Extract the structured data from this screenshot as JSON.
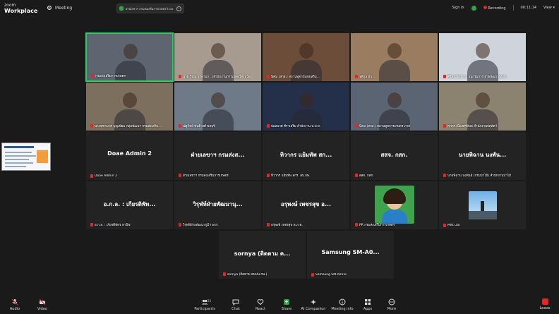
{
  "brand": {
    "line1": "zoom",
    "line2": "Workplace"
  },
  "meeting_label": "Meeting",
  "share_pill_text": "ฝ่ายเลขาฯ กรมส่งเสริมการเกษตร's scr",
  "top_right": {
    "signin": "Sign in",
    "recording": "Recording",
    "timer": "00:11:14",
    "view": "View"
  },
  "tiles": [
    {
      "name": "กรมส่งเสริมการเกษตร",
      "video": true,
      "active": true,
      "bg": "#5d6670"
    },
    {
      "name": "นาย วิชณุ ธาดาแก...(สำนักงานการเกษตรจังหวัด)",
      "video": true,
      "bg": "#a79b8f"
    },
    {
      "name": "นิคม (สกส.) สถานทูตกรมส่งเสริม...",
      "video": true,
      "bg": "#6b4d3a"
    },
    {
      "name": "จุพิกุล พัว...",
      "video": true,
      "bg": "#9a7c60"
    },
    {
      "name": "ศิริพร มิตรงาม อนุกรมการ ฝ่ายพัฒนาพ้นที่...",
      "video": true,
      "bg": "#cfd3dc"
    },
    {
      "name": "นางจุฑามาศ บุญเนียม กลุ่มพัฒนา กรมส่งเสริม...",
      "video": true,
      "bg": "#7d6f5e"
    },
    {
      "name": "ณัฐวิทย์ ขันติวงศ์ ชลบุรี",
      "video": true,
      "bg": "#6e7a88"
    },
    {
      "name": "ปณยเวศ ทีราเสริม สำนักงาน ป.ป.ท.",
      "video": true,
      "bg": "#242f4a"
    },
    {
      "name": "นิคม (สกส.) สถานทูตการเกษตร ภาค",
      "video": true,
      "bg": "#5b6472"
    },
    {
      "name": "ศุภกร เนื่องศรีทับส สำนักงานปศุสัตว์",
      "video": true,
      "bg": "#8c8270"
    },
    {
      "name": "Doae Admin 2",
      "big": "Doae Admin 2"
    },
    {
      "name": "ฝ่ายเลขาฯ กรมส่งเสริมการเกษตร",
      "big": "ฝ่ายเลขาฯ กรมส่งส..."
    },
    {
      "name": "ทิวากร แย้มทัพ สกร. สบ.กษ.",
      "big": "ทิวากร แย้มทัพ สก..."
    },
    {
      "name": "สสจ. กสก.",
      "big": "สสจ. กสก."
    },
    {
      "name": "นายพิฉาน นงพันธ์ (กรมป่าไม้) สำนักงานป่าไม้",
      "big": "นายพิฉาน นงพัน..."
    },
    {
      "name": "อ.ก.ล. : เกียรติพัทร พานิช",
      "big": "อ.ก.ล. : เกียรติพัท..."
    },
    {
      "name": "วิรุฬห์ฝ่ายพัฒนาภูมิฯ อกร.",
      "big": "วิรุฬห์ฝ่ายพัฒนานุ..."
    },
    {
      "name": "อรุพงษ์ เพชรสุข อ.ภ.ด.",
      "big": "อรุพงษ์ เพชรสุข อ..."
    },
    {
      "name": "PR กรมส่งเสริมการเกษตร",
      "avatar": "woman"
    },
    {
      "name": "Mitt Dul",
      "avatar": "mountain"
    },
    {
      "name": "sornya (ติดตาม คพปน.กษ.)",
      "big": "sornya (ติดตาม ค..."
    },
    {
      "name": "Samsung SM-A055F",
      "big": "Samsung SM-A0..."
    }
  ],
  "toolbar": {
    "audio": "Audio",
    "video": "Video",
    "participants": "Participants",
    "participants_count": "23",
    "chat": "Chat",
    "react": "React",
    "share": "Share",
    "ai_companion": "AI Companion",
    "meeting_info": "Meeting info",
    "apps": "Apps",
    "more": "More",
    "leave": "Leave"
  }
}
